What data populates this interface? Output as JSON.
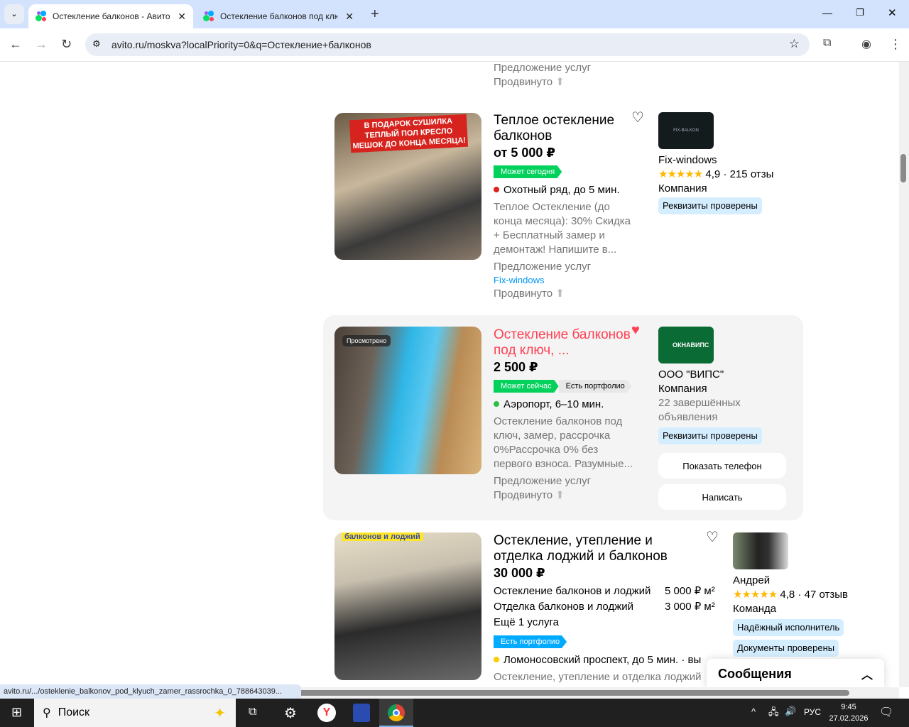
{
  "browser": {
    "tabs": [
      {
        "title": "Остекление балконов - Авито",
        "active": true
      },
      {
        "title": "Остекление балконов под клю",
        "active": false
      }
    ],
    "url": "avito.ru/moskva?localPriority=0&q=Остекление+балконов",
    "status_url": "avito.ru/.../osteklenie_balkonov_pod_klyuch_zamer_rassrochka_0_788643039..."
  },
  "prev_listing": {
    "type": "Предложение услуг",
    "promoted": "Продвинуто"
  },
  "listings": [
    {
      "title": "Теплое остекление балконов",
      "price": "от 5 000 ₽",
      "badges": [
        "Может сегодня"
      ],
      "location": "Охотный ряд, до 5 мин.",
      "location_color": "#e0201b",
      "description": "Теплое Остекление (до конца месяца): 30% Скидка + Бесплатный замер и демонтаж! Напишите в...",
      "type": "Предложение услуг",
      "seller_link": "Fix-windows",
      "promoted": "Продвинуто",
      "favorite": false,
      "image_banner": "В ПОДАРОК СУШИЛКА ТЕПЛЫЙ ПОЛ КРЕСЛО МЕШОК ДО КОНЦА МЕСЯЦА!",
      "seller": {
        "name": "Fix-windows",
        "logo_text": "FIX-BALKON",
        "rating": "4,9",
        "reviews": "215 отзы",
        "kind": "Компания",
        "chips": [
          "Реквизиты проверены"
        ]
      }
    },
    {
      "title": "Остекление балконов под ключ, ...",
      "price": "2 500 ₽",
      "badges": [
        "Может сейчас",
        "Есть портфолио"
      ],
      "viewed_label": "Просмотрено",
      "location": "Аэропорт, 6–10 мин.",
      "location_color": "#2bbf45",
      "description": "Остекление балконов под ключ, замер, рассрочка 0%Рассрочка 0% без первого взноса. Разумные...",
      "type": "Предложение услуг",
      "promoted": "Продвинуто",
      "favorite": true,
      "seller": {
        "name": "ООО \"ВИПС\"",
        "logo_text": "ОКНАВИПС",
        "kind": "Компания",
        "completed": "22 завершённых объявления",
        "chips": [
          "Реквизиты проверены"
        ],
        "show_phone": "Показать телефон",
        "write": "Написать"
      }
    },
    {
      "title": "Остекление, утепление и отделка лоджий и балконов",
      "price": "30 000 ₽",
      "services": [
        {
          "name": "Остекление балконов и лоджий",
          "price": "5 000 ₽ м²"
        },
        {
          "name": "Отделка балконов и лоджий",
          "price": "3 000 ₽ м²"
        }
      ],
      "more_services": "Ещё 1 услуга",
      "badges": [
        "Есть портфолио"
      ],
      "location": "Ломоносовский проспект, до 5 мин. · вы",
      "location_color": "#ffcc00",
      "description": "Остекление, утепление и отделка лоджий",
      "favorite": false,
      "image_banner": "балконов и лоджий",
      "seller": {
        "name": "Андрей",
        "rating": "4,8",
        "reviews": "47 отзыв",
        "kind": "Команда",
        "chips": [
          "Надёжный исполнитель",
          "Документы проверены"
        ]
      }
    }
  ],
  "messages": {
    "label": "Сообщения"
  },
  "taskbar": {
    "search": "Поиск",
    "lang": "РУС",
    "time": "9:45",
    "date": "27.02.2026"
  },
  "colors": {
    "accent_link": "#0099f7",
    "viewed_title": "#ff4053",
    "badge_green": "#02d15c",
    "badge_blue": "#00aaff"
  }
}
